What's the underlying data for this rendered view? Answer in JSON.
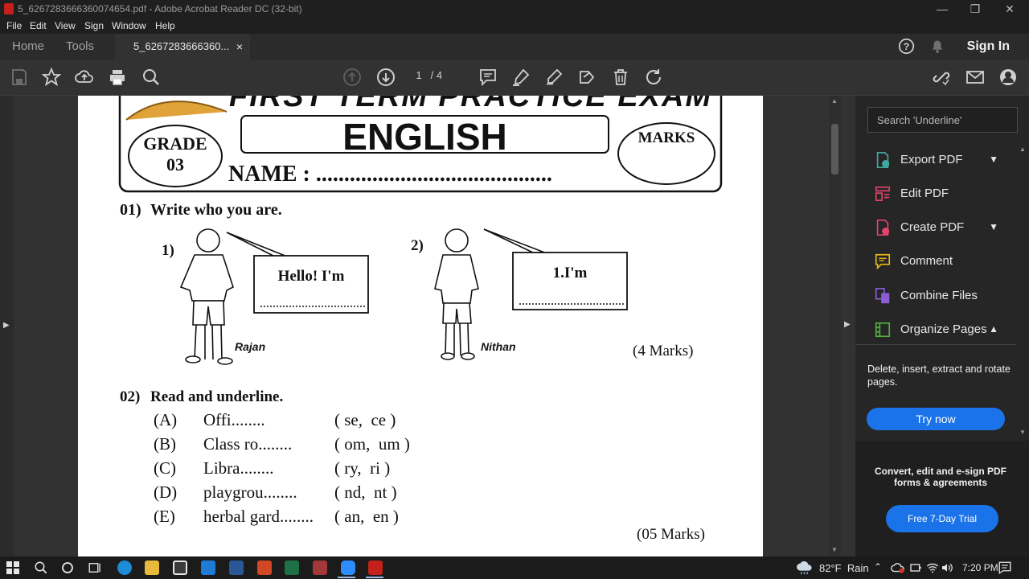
{
  "window": {
    "title": "5_6267283666360074654.pdf - Adobe Acrobat Reader DC (32-bit)",
    "minimize": "—",
    "restore": "❐",
    "close": "✕"
  },
  "menu": [
    "File",
    "Edit",
    "View",
    "Sign",
    "Window",
    "Help"
  ],
  "tabs": {
    "home": "Home",
    "tools": "Tools",
    "document": "5_6267283666360...",
    "close": "×"
  },
  "header": {
    "signin": "Sign In"
  },
  "toolbar": {
    "current_page": "1",
    "page_separator": "/",
    "total_pages": "4"
  },
  "document": {
    "banner_title": "FIRST TERM PRACTICE EXAM",
    "subject": "ENGLISH",
    "grade_label": "GRADE",
    "grade_value": "03",
    "marks_label": "MARKS",
    "name_label": "NAME : ..........................................",
    "q1": {
      "number": "01)",
      "title": "Write who you are.",
      "item1_number": "1)",
      "item1_speech": "Hello! I'm",
      "item1_name": "Rajan",
      "item2_number": "2)",
      "item2_speech": "1.I'm",
      "item2_name": "Nithan",
      "marks": "(4 Marks)"
    },
    "q2": {
      "number": "02)",
      "title": "Read and underline.",
      "items": [
        {
          "letter": "(A)",
          "word": "Offi........",
          "options": "( se,  ce )"
        },
        {
          "letter": "(B)",
          "word": "Class ro........",
          "options": "( om,  um )"
        },
        {
          "letter": "(C)",
          "word": "Libra........",
          "options": "( ry,  ri )"
        },
        {
          "letter": "(D)",
          "word": "playgrou........",
          "options": "( nd,  nt )"
        },
        {
          "letter": "(E)",
          "word": "herbal gard........",
          "options": "( an,  en )"
        }
      ],
      "marks": "(05 Marks)"
    }
  },
  "right_panel": {
    "search_placeholder": "Search 'Underline'",
    "tools": [
      {
        "label": "Export PDF",
        "icon": "export-pdf-icon",
        "color": "#3fa9a0"
      },
      {
        "label": "Edit PDF",
        "icon": "edit-pdf-icon",
        "color": "#e1446b"
      },
      {
        "label": "Create PDF",
        "icon": "create-pdf-icon",
        "color": "#e1446b"
      },
      {
        "label": "Comment",
        "icon": "comment-icon",
        "color": "#e8b81a"
      },
      {
        "label": "Combine Files",
        "icon": "combine-files-icon",
        "color": "#8c5cd6"
      },
      {
        "label": "Organize Pages",
        "icon": "organize-pages-icon",
        "color": "#53b03f"
      }
    ],
    "organize_desc": "Delete, insert, extract and rotate pages.",
    "try_button": "Try now",
    "promo_text": "Convert, edit and e-sign PDF forms & agreements",
    "promo_button": "Free 7-Day Trial"
  },
  "taskbar": {
    "weather": "82°F  Rain",
    "time": "7:20 PM"
  },
  "colors": {
    "accent": "#1a73e8",
    "acrobat_red": "#c4211b"
  }
}
